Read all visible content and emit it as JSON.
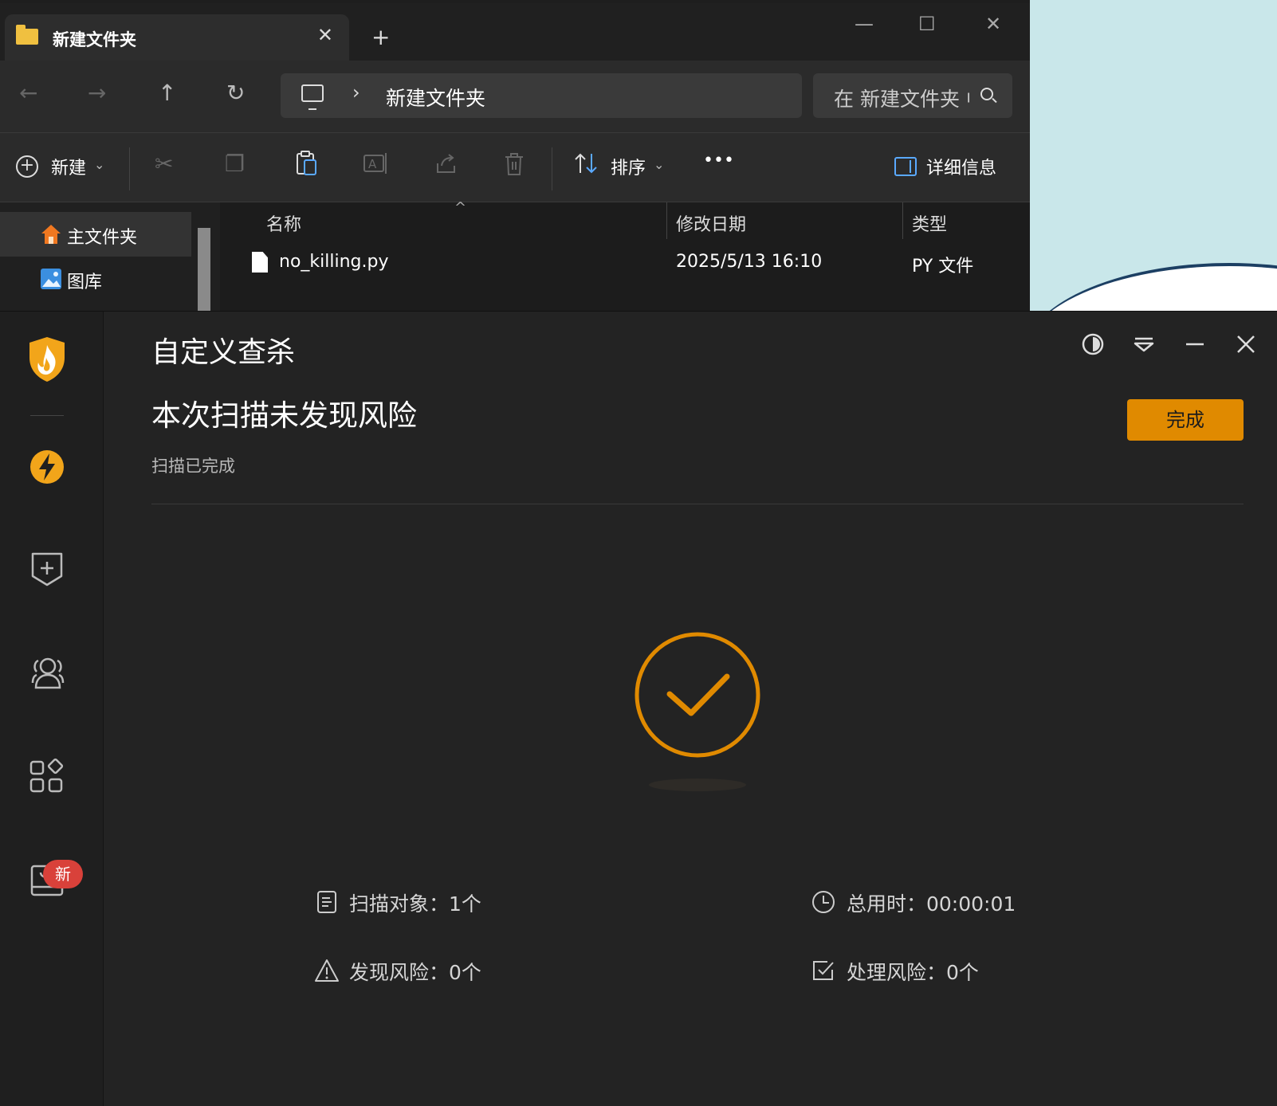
{
  "explorer": {
    "tab_title": "新建文件夹",
    "tab_close_icon": "close-icon",
    "new_tab_label": "+",
    "window_controls": {
      "minimize": "—",
      "maximize": "☐",
      "close": "✕"
    },
    "nav": {
      "back": "←",
      "forward": "→",
      "up": "↑",
      "refresh": "↻"
    },
    "address": {
      "chevron": "›",
      "path": "新建文件夹"
    },
    "search": {
      "placeholder": "在 新建文件夹 中搜索"
    },
    "commands": {
      "new_label": "新建",
      "new_chevron": "⌄",
      "sort_label": "排序",
      "sort_chevron": "⌄",
      "more_label": "•••",
      "details_label": "详细信息"
    },
    "nav_pane": [
      {
        "label": "主文件夹",
        "icon": "home-icon",
        "color": "#f07820"
      },
      {
        "label": "图库",
        "icon": "gallery-icon",
        "color": "#3b8fe0"
      }
    ],
    "columns": {
      "name": "名称",
      "modified": "修改日期",
      "type": "类型"
    },
    "files": [
      {
        "name": "no_killing.py",
        "modified": "2025/5/13 16:10",
        "type": "PY 文件"
      }
    ]
  },
  "app": {
    "title": "自定义查杀",
    "headline": "本次扫描未发现风险",
    "subtitle": "扫描已完成",
    "done_label": "完成",
    "badge_new": "新",
    "accent": "#e08a00",
    "stats": {
      "scanned": "扫描对象：1个",
      "found": "发现风险：0个",
      "elapsed": "总用时：00:00:01",
      "handled": "处理风险：0个"
    }
  }
}
